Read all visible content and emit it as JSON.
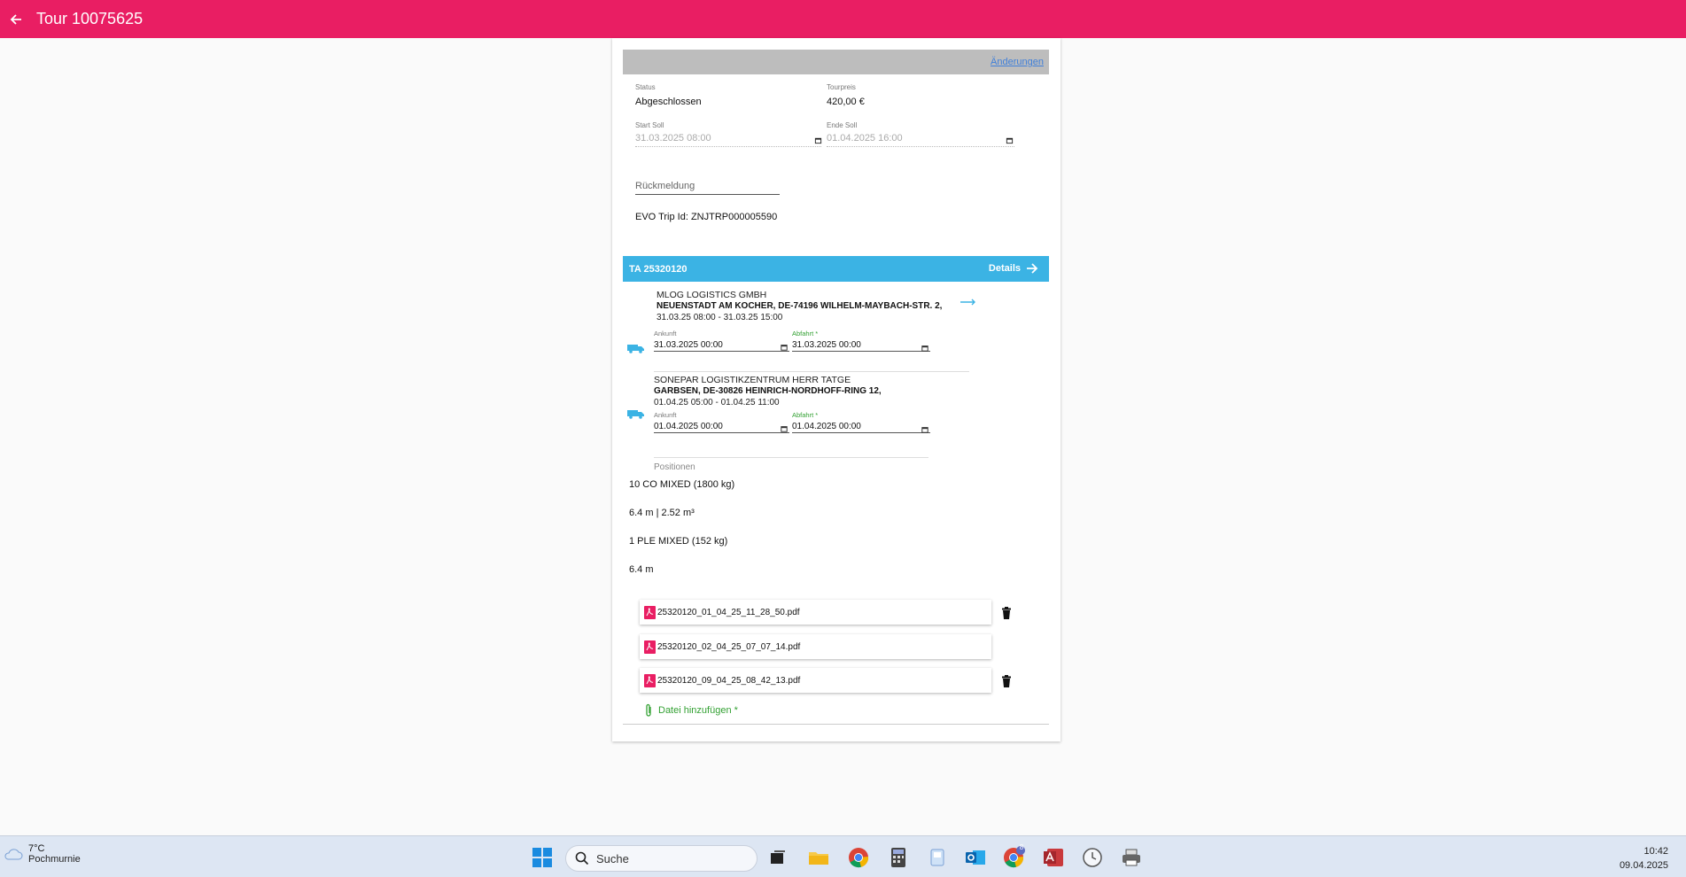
{
  "appbar": {
    "title": "Tour 10075625"
  },
  "header": {
    "changes_link": "Änderungen"
  },
  "tour": {
    "status_label": "Status",
    "status_value": "Abgeschlossen",
    "price_label": "Tourpreis",
    "price_value": "420,00 €",
    "start_label": "Start Soll",
    "start_value": "31.03.2025 08:00",
    "end_label": "Ende Soll",
    "end_value": "01.04.2025 16:00",
    "feedback_label": "Rückmeldung",
    "evo_trip": "EVO Trip Id: ZNJTRP000005590"
  },
  "ta": {
    "title": "TA 25320120",
    "details_label": "Details",
    "stops": [
      {
        "name": "MLOG LOGISTICS GMBH",
        "address": "NEUENSTADT AM KOCHER, DE-74196 WILHELM-MAYBACH-STR. 2,",
        "window": "31.03.25 08:00 - 31.03.25 15:00",
        "arrival_label": "Ankunft",
        "arrival_value": "31.03.2025 00:00",
        "departure_label": "Abfahrt *",
        "departure_value": "31.03.2025 00:00"
      },
      {
        "name": "SONEPAR LOGISTIKZENTRUM HERR TATGE",
        "address": "GARBSEN, DE-30826 HEINRICH-NORDHOFF-RING 12,",
        "window": "01.04.25 05:00 - 01.04.25 11:00",
        "arrival_label": "Ankunft",
        "arrival_value": "01.04.2025 00:00",
        "departure_label": "Abfahrt *",
        "departure_value": "01.04.2025 00:00"
      }
    ],
    "positions_label": "Positionen",
    "positions": [
      "10 CO MIXED (1800 kg)",
      "6.4 m | 2.52 m³",
      "1 PLE MIXED (152 kg)",
      "6.4 m"
    ],
    "files": [
      "25320120_01_04_25_11_28_50.pdf",
      "25320120_02_04_25_07_07_14.pdf",
      "25320120_09_04_25_08_42_13.pdf"
    ],
    "add_file_label": "Datei hinzufügen *"
  },
  "colors": {
    "primary": "#e91e63",
    "accent": "#3bb3e4",
    "success": "#33a133"
  },
  "taskbar": {
    "weather_temp": "7°C",
    "weather_location": "Pochmurnie",
    "search_placeholder": "Suche",
    "chrome_badge": "8",
    "time": "10:42",
    "date": "09.04.2025"
  }
}
